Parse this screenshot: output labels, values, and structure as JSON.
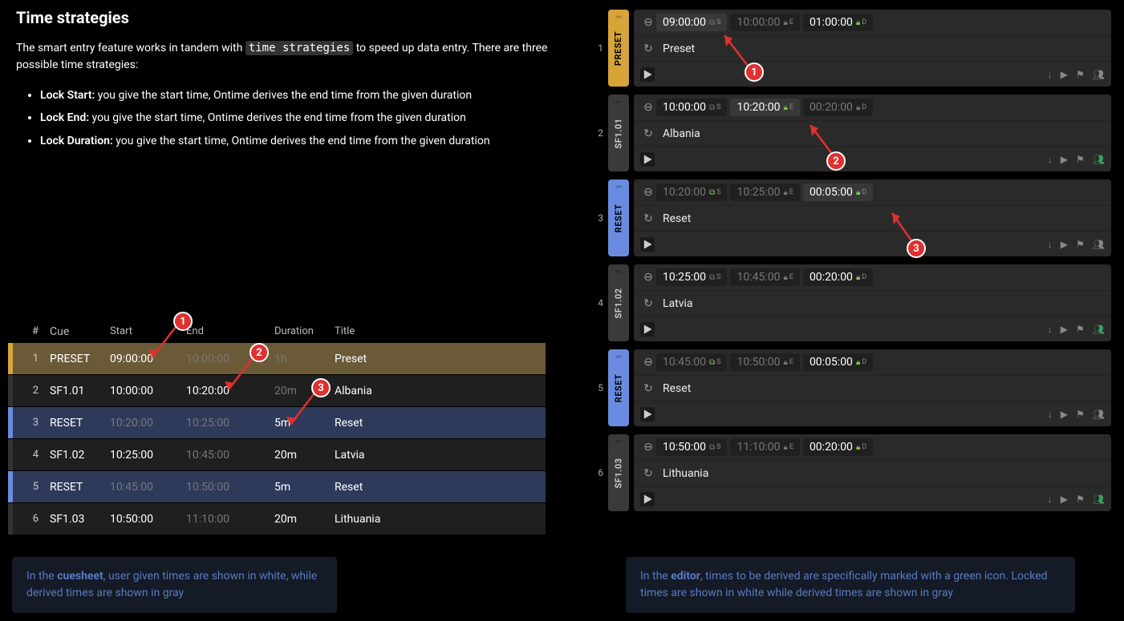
{
  "doc": {
    "title": "Time strategies",
    "para1_a": "The smart entry feature works in tandem with ",
    "para1_b": "time strategies",
    "para1_c": " to speed up data entry. There are three possible time strategies:",
    "bullets": [
      {
        "label": "Lock Start:",
        "text_a": " you give the ",
        "start": "start time",
        "text_b": ", Ontime derives the ",
        "end": "end time",
        "text_c": " from the given ",
        "dur": "duration"
      },
      {
        "label": "Lock End:",
        "text_a": " you give the ",
        "end": "end time",
        "text_b": ", Ontime derives the ",
        "start": "start time",
        "text_c": " from the given ",
        "dur": "duration"
      },
      {
        "label": "Lock Duration:",
        "text_a": " you give the ",
        "dur": "duration",
        "text_b": ", Ontime derives the ",
        "end": "end time",
        "text_c": " from the given ",
        "start": "start time"
      }
    ]
  },
  "cuesheet": {
    "headers": {
      "num": "#",
      "cue": "Cue",
      "start": "Start",
      "end": "End",
      "duration": "Duration",
      "title": "Title"
    },
    "rows": [
      {
        "n": "1",
        "cue": "PRESET",
        "start": "09:00:00",
        "end": "10:00:00",
        "dur": "1h",
        "title": "Preset",
        "type": "preset",
        "start_white": true,
        "end_white": false,
        "dur_white": false
      },
      {
        "n": "2",
        "cue": "SF1.01",
        "start": "10:00:00",
        "end": "10:20:00",
        "dur": "20m",
        "title": "Albania",
        "type": "sf",
        "start_white": true,
        "end_white": true,
        "dur_white": false
      },
      {
        "n": "3",
        "cue": "RESET",
        "start": "10:20:00",
        "end": "10:25:00",
        "dur": "5m",
        "title": "Reset",
        "type": "reset",
        "start_white": false,
        "end_white": false,
        "dur_white": true
      },
      {
        "n": "4",
        "cue": "SF1.02",
        "start": "10:25:00",
        "end": "10:45:00",
        "dur": "20m",
        "title": "Latvia",
        "type": "sf",
        "start_white": true,
        "end_white": false,
        "dur_white": true
      },
      {
        "n": "5",
        "cue": "RESET",
        "start": "10:45:00",
        "end": "10:50:00",
        "dur": "5m",
        "title": "Reset",
        "type": "reset",
        "start_white": false,
        "end_white": false,
        "dur_white": true
      },
      {
        "n": "6",
        "cue": "SF1.03",
        "start": "10:50:00",
        "end": "11:10:00",
        "dur": "20m",
        "title": "Lithuania",
        "type": "sf",
        "start_white": true,
        "end_white": false,
        "dur_white": true
      }
    ]
  },
  "editor": {
    "rows": [
      {
        "n": "1",
        "tab": "PRESET",
        "tabtype": "preset",
        "start": "09:00:00",
        "end": "10:00:00",
        "dur": "01:00:00",
        "title": "Preset",
        "start_w": true,
        "end_w": false,
        "dur_w": true,
        "s_lock": "link-gray",
        "e_lock": "lock-gray",
        "d_lock": "lock-green",
        "people_green": false,
        "start_hl": true
      },
      {
        "n": "2",
        "tab": "SF1.01",
        "tabtype": "sf",
        "start": "10:00:00",
        "end": "10:20:00",
        "dur": "00:20:00",
        "title": "Albania",
        "start_w": true,
        "end_w": true,
        "dur_w": false,
        "s_lock": "link-gray",
        "e_lock": "lock-green",
        "d_lock": "lock-gray",
        "people_green": true,
        "end_hl": true
      },
      {
        "n": "3",
        "tab": "RESET",
        "tabtype": "reset",
        "start": "10:20:00",
        "end": "10:25:00",
        "dur": "00:05:00",
        "title": "Reset",
        "start_w": false,
        "end_w": false,
        "dur_w": true,
        "s_lock": "link-green",
        "e_lock": "lock-gray",
        "d_lock": "lock-green",
        "people_green": false,
        "dur_hl": true
      },
      {
        "n": "4",
        "tab": "SF1.02",
        "tabtype": "sf",
        "start": "10:25:00",
        "end": "10:45:00",
        "dur": "00:20:00",
        "title": "Latvia",
        "start_w": true,
        "end_w": false,
        "dur_w": true,
        "s_lock": "link-gray",
        "e_lock": "lock-gray",
        "d_lock": "lock-green",
        "people_green": true
      },
      {
        "n": "5",
        "tab": "RESET",
        "tabtype": "reset",
        "start": "10:45:00",
        "end": "10:50:00",
        "dur": "00:05:00",
        "title": "Reset",
        "start_w": false,
        "end_w": false,
        "dur_w": true,
        "s_lock": "link-green",
        "e_lock": "lock-gray",
        "d_lock": "lock-green",
        "people_green": false
      },
      {
        "n": "6",
        "tab": "SF1.03",
        "tabtype": "sf",
        "start": "10:50:00",
        "end": "11:10:00",
        "dur": "00:20:00",
        "title": "Lithuania",
        "start_w": true,
        "end_w": false,
        "dur_w": true,
        "s_lock": "link-gray",
        "e_lock": "lock-gray",
        "d_lock": "lock-green",
        "people_green": true
      }
    ],
    "sup_s": "S",
    "sup_e": "E",
    "sup_d": "D"
  },
  "callouts": {
    "c1": "1",
    "c2": "2",
    "c3": "3"
  },
  "captions": {
    "left_a": "In the ",
    "left_b": "cuesheet",
    "left_c": ", user given times are shown in white, while derived times are shown in gray",
    "right_a": "In the ",
    "right_b": "editor",
    "right_c": ", times to be derived are specifically marked with a green icon. Locked times are shown in white while derived times are shown in gray"
  }
}
